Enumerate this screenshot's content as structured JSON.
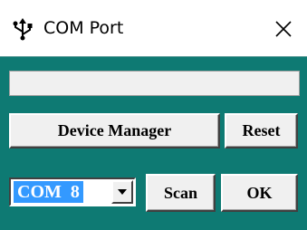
{
  "window": {
    "title": "COM Port",
    "icon": "usb-icon",
    "close_icon": "close-icon"
  },
  "status": {
    "value": ""
  },
  "buttons": {
    "device_manager": "Device Manager",
    "reset": "Reset",
    "scan": "Scan",
    "ok": "OK"
  },
  "port_select": {
    "selected": "COM  8",
    "arrow_icon": "dropdown-arrow-icon"
  },
  "colors": {
    "client_background": "#0e7a73",
    "selection_highlight": "#3399ff",
    "button_face": "#f0f0f0"
  }
}
